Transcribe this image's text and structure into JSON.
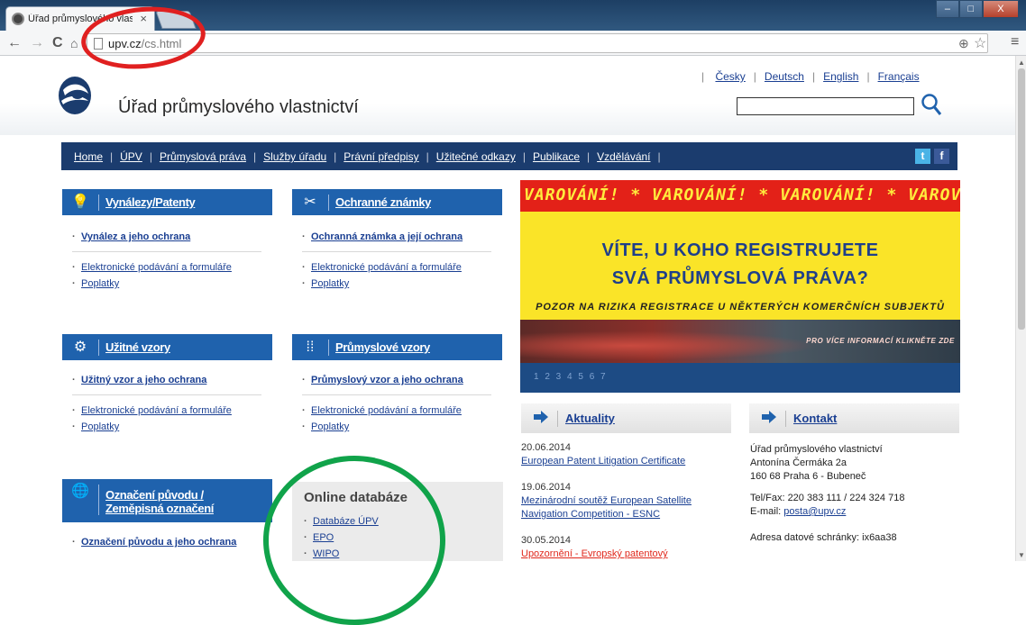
{
  "browser": {
    "tab_title": "Úřad průmyslového vlastn",
    "tab_close": "×",
    "url_host": "upv.cz",
    "url_path": "/cs.html",
    "window_buttons": [
      "–",
      "□",
      "X"
    ]
  },
  "header": {
    "site_title": "Úřad průmyslového vlastnictví",
    "languages": [
      "Česky",
      "Deutsch",
      "English",
      "Français"
    ],
    "search_placeholder": ""
  },
  "nav": {
    "items": [
      "Home",
      "ÚPV",
      "Průmyslová práva",
      "Služby úřadu",
      "Právní předpisy",
      "Užitečné odkazy",
      "Publikace",
      "Vzdělávání"
    ],
    "twitter": "t",
    "facebook": "f"
  },
  "categories": [
    {
      "title": "Vynálezy/Patenty",
      "icon": "lightbulb-icon",
      "links": [
        "Vynález a jeho ochrana",
        "Elektronické podávání a formuláře",
        "Poplatky"
      ]
    },
    {
      "title": "Ochranné známky",
      "icon": "trademark-icon",
      "links": [
        "Ochranná známka a její ochrana",
        "Elektronické podávání a formuláře",
        "Poplatky"
      ]
    },
    {
      "title": "Užitné vzory",
      "icon": "gear-icon",
      "links": [
        "Užitný vzor a jeho ochrana",
        "Elektronické podávání a formuláře",
        "Poplatky"
      ]
    },
    {
      "title": "Průmyslové vzory",
      "icon": "dots-icon",
      "links": [
        "Průmyslový vzor a jeho ochrana",
        "Elektronické podávání a formuláře",
        "Poplatky"
      ]
    },
    {
      "title_line1": "Označení původu /",
      "title_line2": "Zeměpisná označení",
      "icon": "globe-icon",
      "links": [
        "Označení původu a jeho ochrana"
      ]
    }
  ],
  "online_db": {
    "title": "Online databáze",
    "links": [
      "Databáze ÚPV",
      "EPO",
      "WIPO"
    ]
  },
  "banner": {
    "warning": "VAROVÁNÍ! * VAROVÁNÍ! * VAROVÁNÍ! * VAROVÁNÍ",
    "line1": "VÍTE, U KOHO REGISTRUJETE",
    "line2": "SVÁ PRŮMYSLOVÁ PRÁVA?",
    "line3": "POZOR NA RIZIKA REGISTRACE U NĚKTERÝCH KOMERČNÍCH SUBJEKTŮ",
    "more": "PRO VÍCE INFORMACÍ KLIKNĚTE ZDE",
    "pages": "1 2 3 4 5 6 7"
  },
  "news": {
    "title": "Aktuality",
    "items": [
      {
        "date": "20.06.2014",
        "text": "European Patent Litigation Certificate"
      },
      {
        "date": "19.06.2014",
        "text": "Mezinárodní soutěž European Satellite Navigation Competition - ESNC"
      },
      {
        "date": "30.05.2014",
        "text": "Upozornění - Evropský patentový"
      }
    ]
  },
  "contact": {
    "title": "Kontakt",
    "name": "Úřad průmyslového vlastnictví",
    "street": "Antonína Čermáka 2a",
    "city": "160 68 Praha 6 - Bubeneč",
    "telfax": "Tel/Fax: 220 383 111 / 224 324 718",
    "email_label": "E-mail:",
    "email": "posta@upv.cz",
    "databox": "Adresa datové schránky: ix6aa38"
  }
}
